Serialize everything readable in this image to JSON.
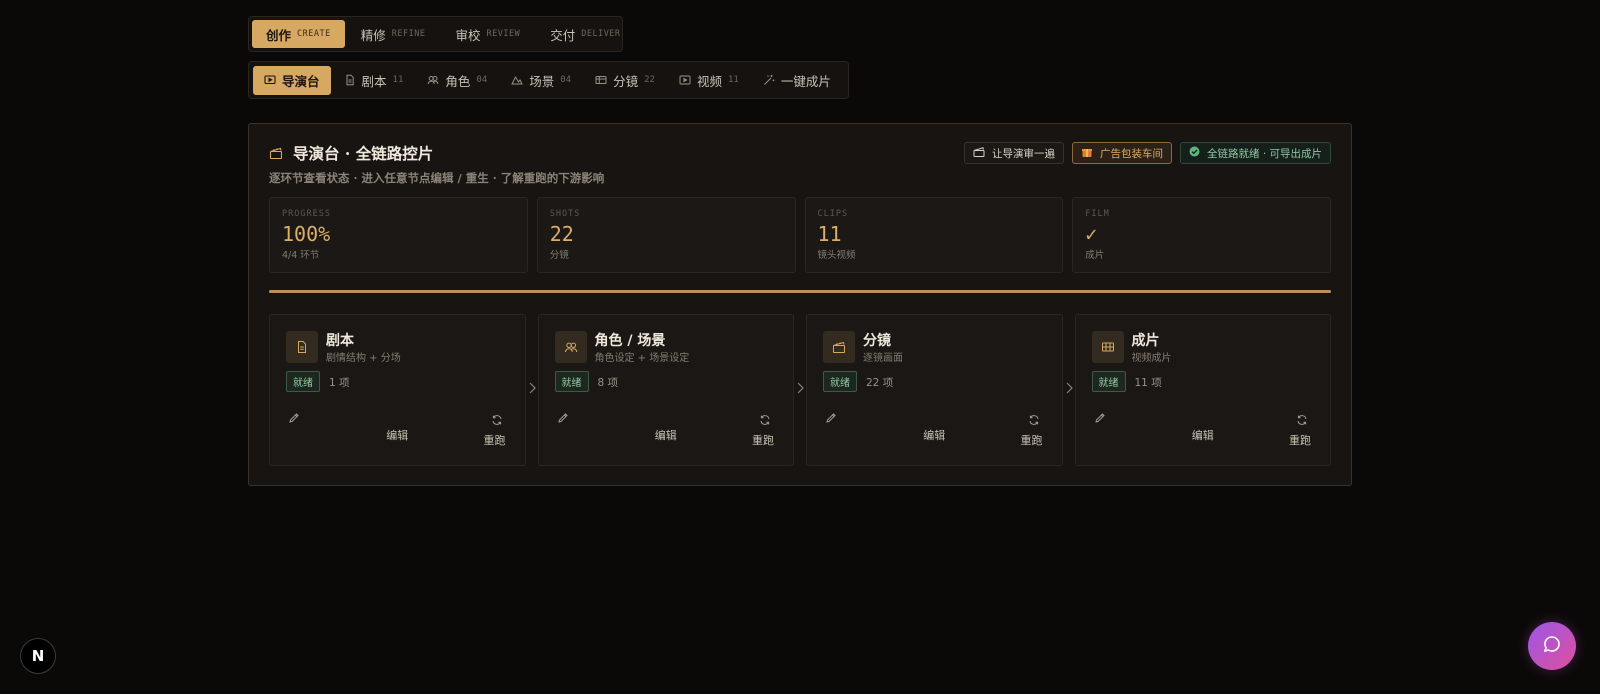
{
  "phase_tabs": [
    {
      "label": "创作",
      "en": "CREATE",
      "active": true
    },
    {
      "label": "精修",
      "en": "REFINE",
      "active": false
    },
    {
      "label": "审校",
      "en": "REVIEW",
      "active": false
    },
    {
      "label": "交付",
      "en": "DELIVER",
      "active": false
    }
  ],
  "module_tabs": [
    {
      "label": "导演台",
      "count": "",
      "icon": "monitor-play-icon",
      "active": true
    },
    {
      "label": "剧本",
      "count": "11",
      "icon": "document-icon",
      "active": false
    },
    {
      "label": "角色",
      "count": "04",
      "icon": "users-icon",
      "active": false
    },
    {
      "label": "场景",
      "count": "04",
      "icon": "mountain-icon",
      "active": false
    },
    {
      "label": "分镜",
      "count": "22",
      "icon": "storyboard-icon",
      "active": false
    },
    {
      "label": "视频",
      "count": "11",
      "icon": "video-icon",
      "active": false
    },
    {
      "label": "一键成片",
      "count": "",
      "icon": "magic-wand-icon",
      "active": false
    }
  ],
  "panel": {
    "title": "导演台 · 全链路控片",
    "subtitle": "逐环节查看状态 · 进入任意节点编辑 / 重生 · 了解重跑的下游影响",
    "actions": {
      "review": "让导演审一遍",
      "ad_workshop": "广告包装车间",
      "status": "全链路就绪 · 可导出成片"
    },
    "stats": [
      {
        "key": "PROGRESS",
        "value": "100%",
        "sub": "4/4 环节"
      },
      {
        "key": "SHOTS",
        "value": "22",
        "sub": "分镜"
      },
      {
        "key": "CLIPS",
        "value": "11",
        "sub": "镜头视频"
      },
      {
        "key": "FILM",
        "value": "✓",
        "sub": "成片"
      }
    ],
    "progress": 1.0,
    "nodes": [
      {
        "title": "剧本",
        "sub": "剧情结构 + 分场",
        "badge": "就绪",
        "count": "1 项",
        "edit": "编辑",
        "rerun": "重跑",
        "icon": "document-icon"
      },
      {
        "title": "角色 / 场景",
        "sub": "角色设定 + 场景设定",
        "badge": "就绪",
        "count": "8 项",
        "edit": "编辑",
        "rerun": "重跑",
        "icon": "users-icon"
      },
      {
        "title": "分镜",
        "sub": "逐镜画面",
        "badge": "就绪",
        "count": "22 项",
        "edit": "编辑",
        "rerun": "重跑",
        "icon": "clapperboard-icon"
      },
      {
        "title": "成片",
        "sub": "视频成片",
        "badge": "就绪",
        "count": "11 项",
        "edit": "编辑",
        "rerun": "重跑",
        "icon": "film-icon"
      }
    ]
  },
  "next_badge": "N",
  "colors": {
    "accent": "#d7a862",
    "background": "#0b0908",
    "panel": "#171412",
    "ready_green": "#93c9a0"
  }
}
